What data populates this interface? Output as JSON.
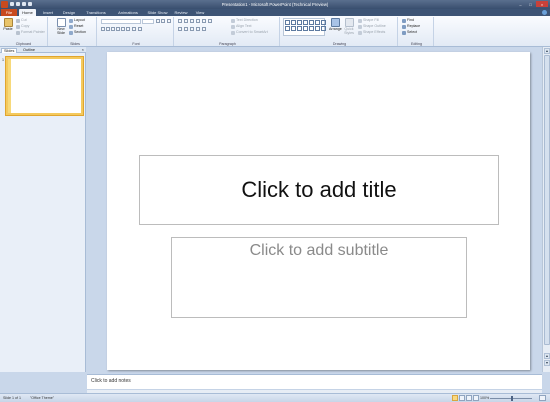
{
  "window": {
    "title": "Presentation1 - Microsoft PowerPoint (Technical Preview)"
  },
  "tabs": {
    "file": "File",
    "items": [
      "Home",
      "Insert",
      "Design",
      "Transitions",
      "Animations",
      "Slide Show",
      "Review",
      "View"
    ],
    "active": "Home"
  },
  "ribbon": {
    "clipboard": {
      "label": "Clipboard",
      "paste": "Paste",
      "cut": "Cut",
      "copy": "Copy",
      "format_painter": "Format Painter"
    },
    "slides": {
      "label": "Slides",
      "new_slide": "New Slide",
      "layout": "Layout",
      "reset": "Reset",
      "section": "Section"
    },
    "font": {
      "label": "Font"
    },
    "paragraph": {
      "label": "Paragraph",
      "text_direction": "Text Direction",
      "align_text": "Align Text",
      "convert_smartart": "Convert to SmartArt"
    },
    "drawing": {
      "label": "Drawing",
      "arrange": "Arrange",
      "quick_styles": "Quick Styles",
      "shape_fill": "Shape Fill",
      "shape_outline": "Shape Outline",
      "shape_effects": "Shape Effects"
    },
    "editing": {
      "label": "Editing",
      "find": "Find",
      "replace": "Replace",
      "select": "Select"
    }
  },
  "slides_pane": {
    "tab_slides": "Slides",
    "tab_outline": "Outline",
    "close": "×",
    "thumb_number": "1"
  },
  "slide": {
    "title_placeholder": "Click to add title",
    "subtitle_placeholder": "Click to add subtitle"
  },
  "notes": {
    "placeholder": "Click to add notes"
  },
  "status": {
    "slide_info": "Slide 1 of 1",
    "theme": "\"Office Theme\"",
    "zoom": "100%"
  },
  "colors": {
    "file_tab": "#c84a1f",
    "tab_strip": "#3d5475",
    "workspace": "#c9d7ea",
    "selected_thumb_border": "#f4c95d"
  }
}
